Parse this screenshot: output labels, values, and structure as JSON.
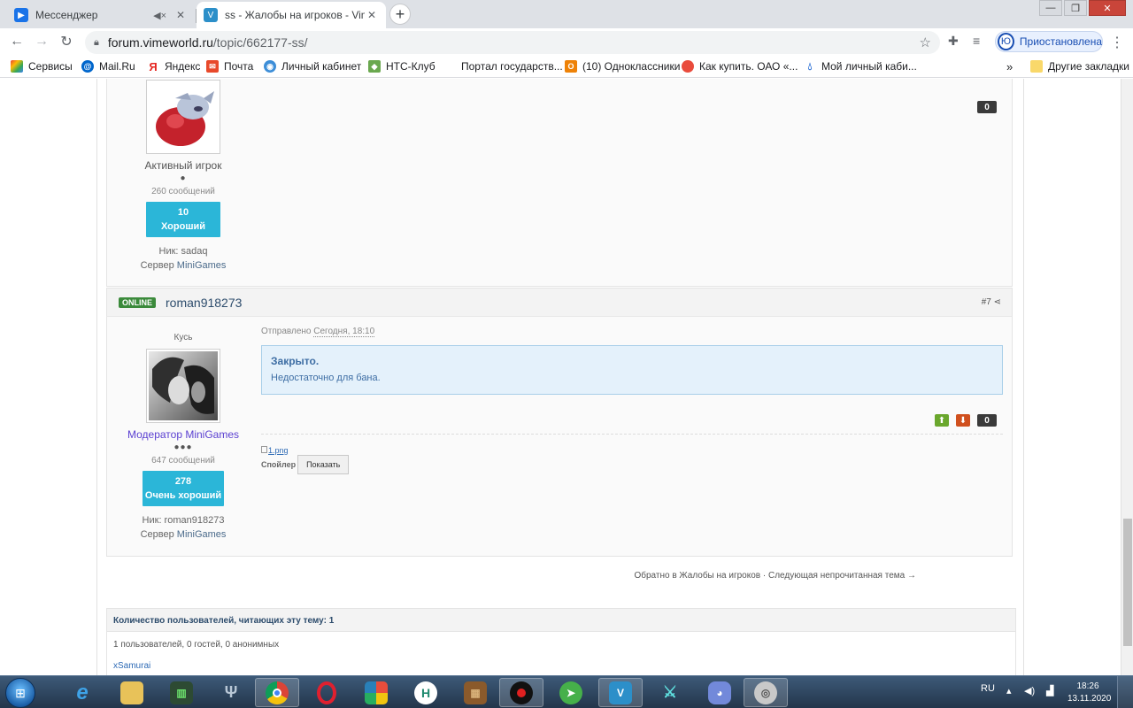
{
  "browser": {
    "tabs": [
      {
        "title": "Мессенджер",
        "state": "inactive"
      },
      {
        "title": "ss - Жалобы на игроков - VimeWorld",
        "state": "active"
      }
    ],
    "url_host": "forum.vimeworld.ru",
    "url_path": "/topic/662177-ss/",
    "profile_initial": "Ю",
    "profile_label": "Приостановлена",
    "bookmarks": [
      "Сервисы",
      "Mail.Ru",
      "Яндекс",
      "Почта",
      "Личный кабинет",
      "НТС-Клуб",
      "Портал государств...",
      "(10) Одноклассники",
      "Как купить. ОАО «...",
      "Мой личный каби..."
    ],
    "bookmarks_more": "»",
    "other_bookmarks": "Другие закладки"
  },
  "post1": {
    "rank": "Активный игрок",
    "pips": "●",
    "post_count": "260 сообщений",
    "rep_value": "10",
    "rep_label": "Хороший",
    "nick": "Ник: sadaq",
    "server_prefix": "Сервер ",
    "server": "MiniGames",
    "rep_score": "0"
  },
  "post2": {
    "online": "ONLINE",
    "author": "roman918273",
    "post_num": "#7",
    "title_above": "Кусь",
    "group": "Модератор MiniGames",
    "pips": "●●●",
    "post_count": "647 сообщений",
    "rep_value": "278",
    "rep_label": "Очень хороший",
    "nick": "Ник: roman918273",
    "server_prefix": "Сервер ",
    "server": "MiniGames",
    "posted_prefix": "Отправлено ",
    "posted_time": "Сегодня, 18:10",
    "quote_title": "Закрыто.",
    "quote_text": "Недостаточно для бана.",
    "rep_score": "0",
    "attachment": "1.png",
    "spoiler_label": "Спойлер",
    "spoiler_button": "Показать"
  },
  "footer_nav": {
    "back": "Обратно в Жалобы на игроков",
    "sep": " · ",
    "next": "Следующая непрочитанная тема →"
  },
  "who": {
    "title": "Количество пользователей, читающих эту тему: 1",
    "stats": "1 пользователей, 0 гостей, 0 анонимных",
    "user": "xSamurai"
  },
  "taskbar": {
    "lang": "RU",
    "time": "18:26",
    "date": "13.11.2020"
  }
}
